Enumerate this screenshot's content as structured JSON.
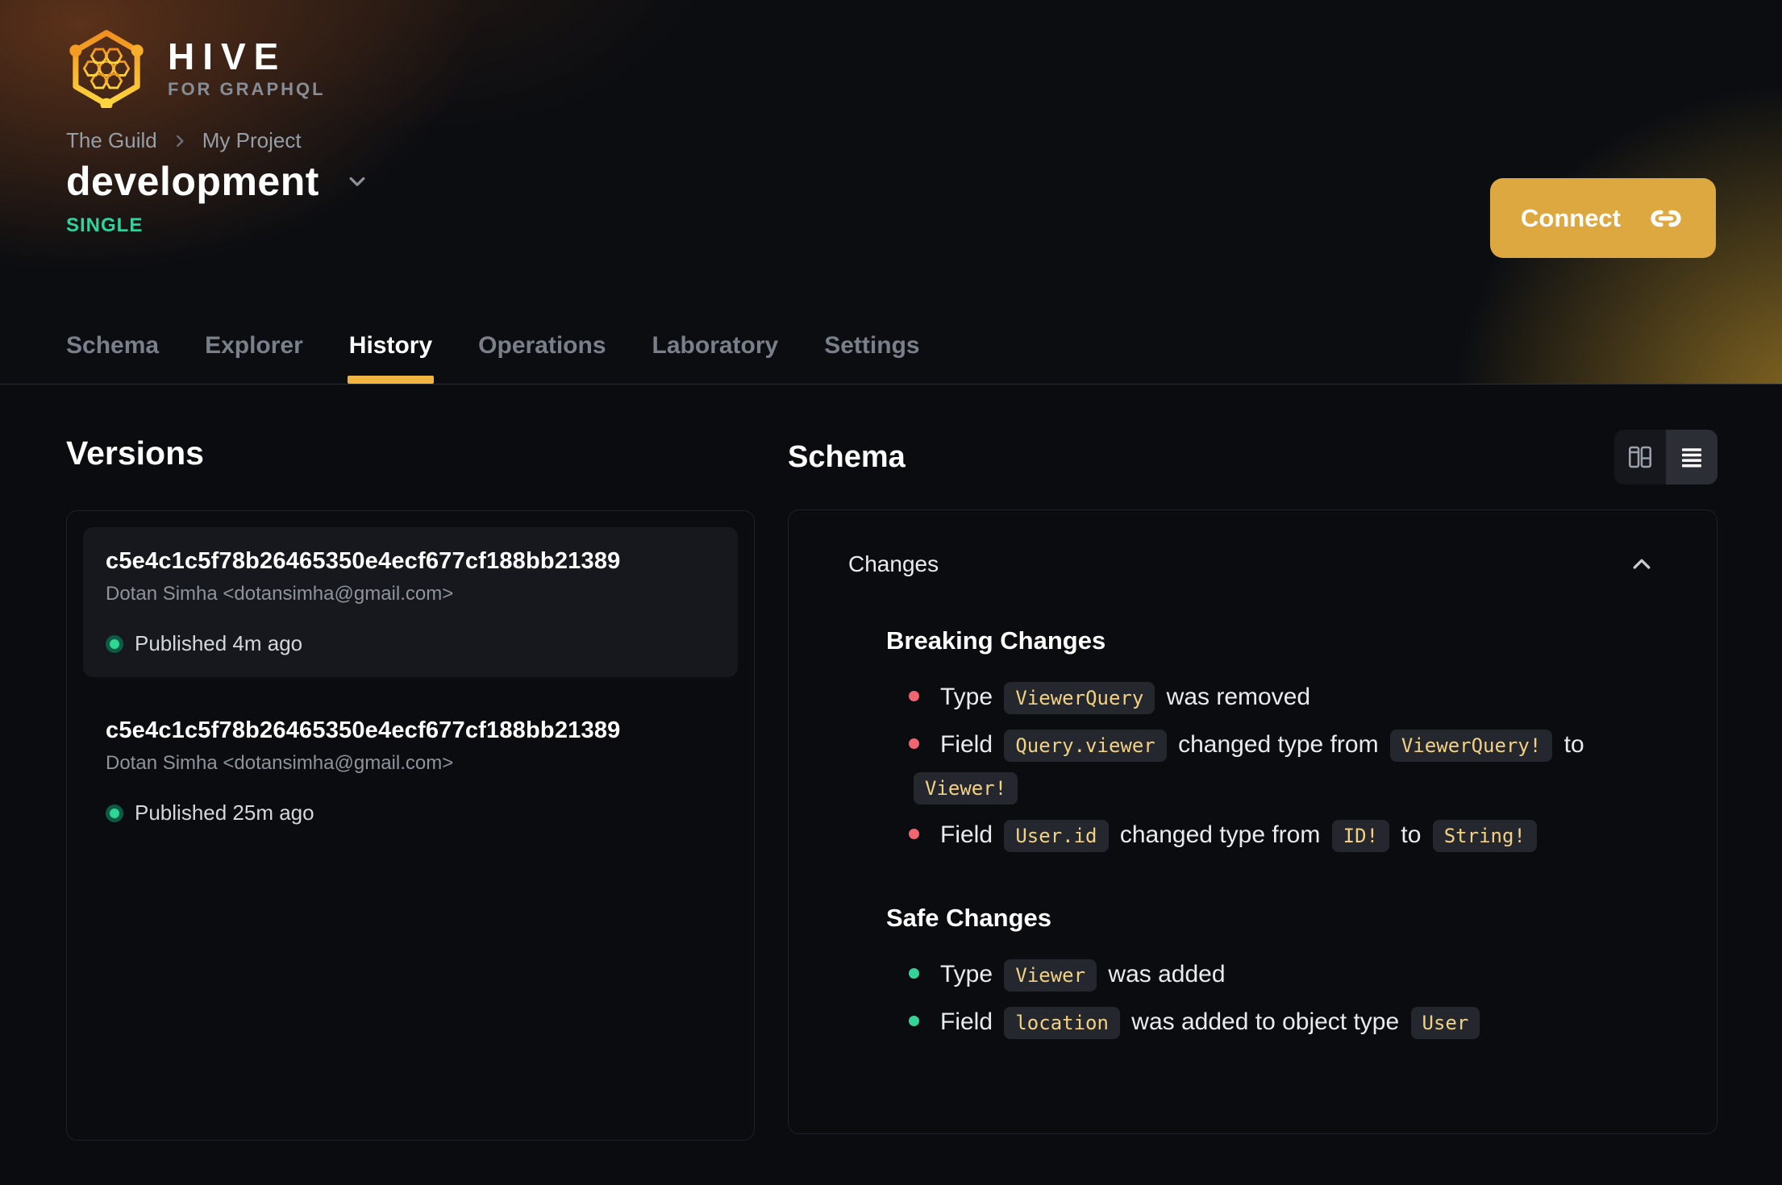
{
  "colors": {
    "accent": "#dda840",
    "tab_underline": "#f0b440",
    "badge_green": "#2ed3a0",
    "safe_green": "#34d399",
    "breaking_red": "#ef6672",
    "code_text": "#f2d184",
    "published_dot": "#2fd794"
  },
  "brand": {
    "name": "HIVE",
    "tagline": "FOR GRAPHQL",
    "logo_icon": "hive-hexagon-logo"
  },
  "breadcrumb": {
    "items": [
      "The Guild",
      "My Project"
    ],
    "separator_icon": "chevron-right-icon"
  },
  "target": {
    "title": "development",
    "dropdown_icon": "chevron-down-icon",
    "badge": "SINGLE"
  },
  "header": {
    "connect_label": "Connect",
    "connect_icon": "link-icon"
  },
  "tabs": {
    "items": [
      {
        "label": "Schema",
        "active": false
      },
      {
        "label": "Explorer",
        "active": false
      },
      {
        "label": "History",
        "active": true
      },
      {
        "label": "Operations",
        "active": false
      },
      {
        "label": "Laboratory",
        "active": false
      },
      {
        "label": "Settings",
        "active": false
      }
    ]
  },
  "versions_panel": {
    "title": "Versions",
    "items": [
      {
        "hash": "c5e4c1c5f78b26465350e4ecf677cf188bb21389",
        "author": "Dotan Simha <dotansimha@gmail.com>",
        "status": "Published 4m ago",
        "selected": true
      },
      {
        "hash": "c5e4c1c5f78b26465350e4ecf677cf188bb21389",
        "author": "Dotan Simha <dotansimha@gmail.com>",
        "status": "Published 25m ago",
        "selected": false
      }
    ]
  },
  "schema_panel": {
    "title": "Schema",
    "view_toggle": [
      {
        "icon": "columns-view-icon",
        "selected": false
      },
      {
        "icon": "list-view-icon",
        "selected": true
      }
    ],
    "changes": {
      "title": "Changes",
      "collapse_icon": "chevron-up-icon",
      "groups": [
        {
          "title": "Breaking Changes",
          "severity": "breaking",
          "items": [
            [
              {
                "text": "Type "
              },
              {
                "code": "ViewerQuery"
              },
              {
                "text": " was removed"
              }
            ],
            [
              {
                "text": "Field "
              },
              {
                "code": "Query.viewer"
              },
              {
                "text": " changed type from "
              },
              {
                "code": "ViewerQuery!"
              },
              {
                "text": " to "
              },
              {
                "code": "Viewer!"
              }
            ],
            [
              {
                "text": "Field "
              },
              {
                "code": "User.id"
              },
              {
                "text": " changed type from "
              },
              {
                "code": "ID!"
              },
              {
                "text": " to "
              },
              {
                "code": "String!"
              }
            ]
          ]
        },
        {
          "title": "Safe Changes",
          "severity": "safe",
          "items": [
            [
              {
                "text": "Type "
              },
              {
                "code": "Viewer"
              },
              {
                "text": " was added"
              }
            ],
            [
              {
                "text": "Field "
              },
              {
                "code": "location"
              },
              {
                "text": " was added to object type "
              },
              {
                "code": "User"
              }
            ]
          ]
        }
      ]
    }
  }
}
